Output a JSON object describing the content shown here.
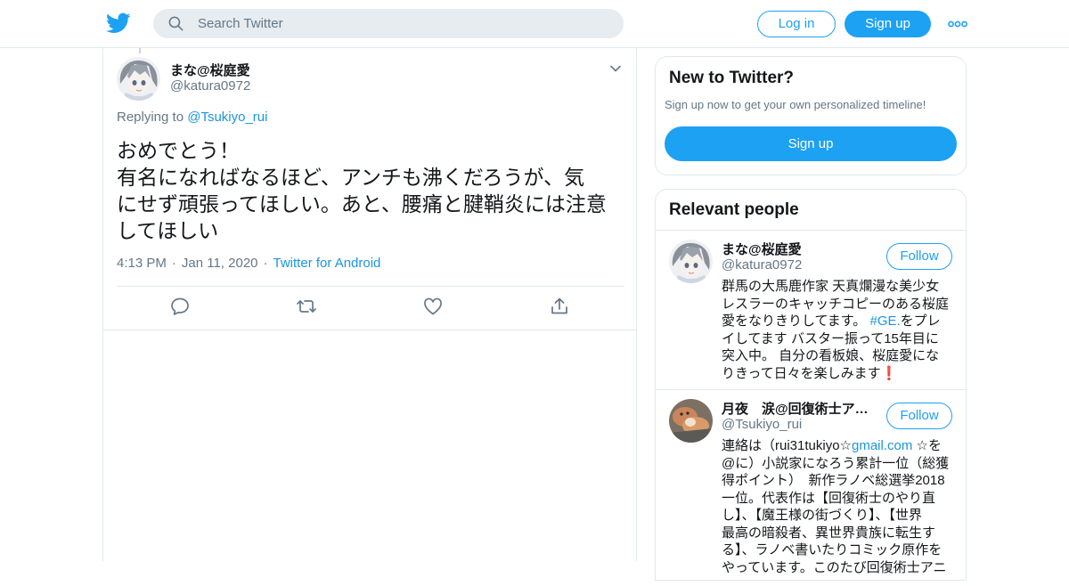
{
  "header": {
    "logo_icon": "twitter-bird-icon",
    "search": {
      "placeholder": "Search Twitter",
      "icon": "search-icon"
    },
    "login_label": "Log in",
    "signup_label": "Sign up",
    "more_icon": "more-dots-icon"
  },
  "tweet": {
    "author_name": "まな@桜庭愛",
    "author_handle": "@katura0972",
    "replying_prefix": "Replying to",
    "replying_to": "@Tsukiyo_rui",
    "text_lines": [
      "おめでとう！",
      "有名になればなるほど、アンチも沸くだろうが、気",
      "にせず頑張ってほしい。あと、腰痛と腱鞘炎には注意",
      "してほしい"
    ],
    "time": "4:13 PM",
    "date": "Jan 11, 2020",
    "source": "Twitter for Android",
    "actions": [
      "reply-icon",
      "retweet-icon",
      "like-icon",
      "share-icon"
    ]
  },
  "sidebar": {
    "new_to_twitter": {
      "title": "New to Twitter?",
      "subtitle": "Sign up now to get your own personalized timeline!",
      "signup_label": "Sign up"
    },
    "relevant_people": {
      "title": "Relevant people",
      "people": [
        {
          "name": "まな@桜庭愛",
          "handle": "@katura0972",
          "follow_label": "Follow",
          "bio_lines": [
            "群馬の大馬鹿作家 天真爛漫な美少女",
            "レスラーのキャッチコピーのある桜庭",
            "愛をなりきりしてます。",
            "イしてます バスター振って15年目に",
            "突入中。 自分の看板娘、桜庭愛にな",
            "りきって日々を楽しみます"
          ],
          "bio_hashtag": "#GE.",
          "bio_after_hashtag": "をプレ",
          "bio_emoji": "❗"
        },
        {
          "name": "月夜　涙@回復術士ア…",
          "handle": "@Tsukiyo_rui",
          "follow_label": "Follow",
          "bio_line1_prefix": "連絡は（rui31tukiyo☆",
          "bio_line1_link": "gmail.com",
          "bio_line1_suffix": " ☆を",
          "bio_lines": [
            "@に）小説家になろう累計一位（総獲",
            "得ポイント）　新作ラノベ総選挙2018",
            "一位。代表作は【回復術士のやり直",
            "し】、【魔王様の街づくり】、【世界",
            "最高の暗殺者、異世界貴族に転生す",
            "る】、ラノベ書いたりコミック原作を",
            "やっています。このたび回復術士アニ"
          ]
        }
      ]
    }
  },
  "colors": {
    "accent": "#1da1f2",
    "link": "#1b95e0",
    "muted": "#657786",
    "border": "#e1e8ed"
  }
}
